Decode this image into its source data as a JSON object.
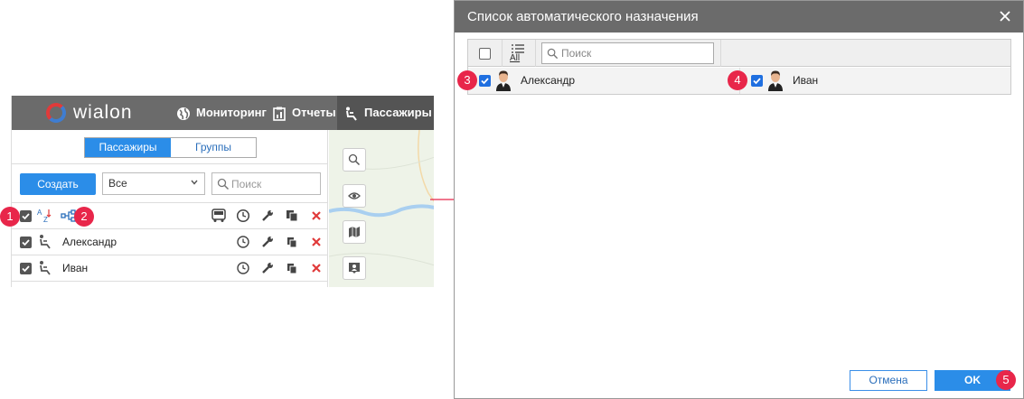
{
  "left_app": {
    "logo_text": "wialon",
    "nav": {
      "monitoring": "Мониторинг",
      "reports": "Отчеты",
      "passengers": "Пассажиры"
    },
    "tabs": {
      "passengers": "Пассажиры",
      "groups": "Группы"
    },
    "create_button": "Создать",
    "filter_select": "Все",
    "search_placeholder": "Поиск",
    "rows": [
      {
        "name": "Александр"
      },
      {
        "name": "Иван"
      }
    ],
    "icons": {
      "sort": "sort-az-icon",
      "auto_assign": "auto-assign-icon",
      "bus": "bus-icon",
      "history": "history-icon",
      "wrench": "wrench-icon",
      "copy": "copy-icon",
      "delete": "delete-icon"
    }
  },
  "dialog": {
    "title": "Список автоматического назначения",
    "all_label": "All",
    "search_placeholder": "Поиск",
    "items": [
      {
        "name": "Александр",
        "checked": true
      },
      {
        "name": "Иван",
        "checked": true
      }
    ],
    "cancel_button": "Отмена",
    "ok_button": "OK"
  },
  "badges": [
    "1",
    "2",
    "3",
    "4",
    "5"
  ],
  "colors": {
    "accent": "#2b8de8",
    "header_bg": "#6b6b6b",
    "badge": "#e8264a",
    "delete_red": "#e03a3a"
  }
}
